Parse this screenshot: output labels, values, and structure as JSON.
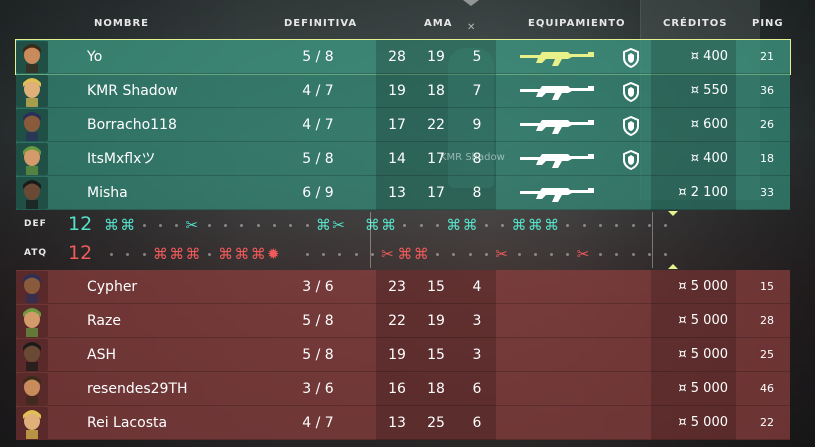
{
  "header": {
    "name": "NOMBRE",
    "final": "DEFINITIVA",
    "kda": "AMA",
    "equipment": "EQUIPAMIENTO",
    "credits": "CRÉDITOS",
    "ping": "PING"
  },
  "colors": {
    "ally": "#328c78",
    "enemy": "#8c3e3e",
    "self_highlight": "#e5f08f",
    "ally_icon": "#55e0c8",
    "enemy_icon": "#f05a5a",
    "weapon_self": "#e8f08a"
  },
  "ally_team": [
    {
      "name": "Yo",
      "definitiva": "5 / 8",
      "kills": "28",
      "deaths": "19",
      "assists": "5",
      "credits": "¤ 400",
      "ping": "21",
      "weapon": "rifle-icon",
      "shield": "shield-icon",
      "self": true
    },
    {
      "name": "KMR Shadow",
      "definitiva": "4 / 7",
      "kills": "19",
      "deaths": "18",
      "assists": "7",
      "credits": "¤ 550",
      "ping": "36",
      "weapon": "rifle-icon",
      "shield": "shield-icon"
    },
    {
      "name": "Borracho118",
      "definitiva": "4 / 7",
      "kills": "17",
      "deaths": "22",
      "assists": "9",
      "credits": "¤ 600",
      "ping": "26",
      "weapon": "rifle-icon",
      "shield": "shield-icon"
    },
    {
      "name": "ItsMxflxツ",
      "definitiva": "5 / 8",
      "kills": "14",
      "deaths": "17",
      "assists": "8",
      "credits": "¤ 400",
      "ping": "18",
      "weapon": "rifle-icon",
      "shield": "shield-icon"
    },
    {
      "name": "Misha",
      "definitiva": "6 / 9",
      "kills": "13",
      "deaths": "17",
      "assists": "8",
      "credits": "¤ 2 100",
      "ping": "33",
      "weapon": "rifle-icon",
      "shield": ""
    }
  ],
  "enemy_team": [
    {
      "name": "Cypher",
      "definitiva": "3 / 6",
      "kills": "23",
      "deaths": "15",
      "assists": "4",
      "credits": "¤ 5 000",
      "ping": "15"
    },
    {
      "name": "Raze",
      "definitiva": "5 / 8",
      "kills": "22",
      "deaths": "19",
      "assists": "3",
      "credits": "¤ 5 000",
      "ping": "28"
    },
    {
      "name": "ASH",
      "definitiva": "5 / 8",
      "kills": "19",
      "deaths": "15",
      "assists": "3",
      "credits": "¤ 5 000",
      "ping": "25"
    },
    {
      "name": "resendes29TH",
      "definitiva": "3 / 6",
      "kills": "16",
      "deaths": "18",
      "assists": "6",
      "credits": "¤ 5 000",
      "ping": "46"
    },
    {
      "name": "Rei Lacosta",
      "definitiva": "4 / 7",
      "kills": "13",
      "deaths": "25",
      "assists": "6",
      "credits": "¤ 5 000",
      "ping": "22"
    }
  ],
  "timeline": {
    "def_label": "DEF",
    "atq_label": "ATQ",
    "def_score": "12",
    "atq_score": "12",
    "def_rounds": [
      "elim",
      "elim",
      "-",
      "-",
      "-",
      "defuse",
      "-",
      "-",
      "-",
      "-",
      "-",
      "-",
      "-",
      "elim",
      "defuse",
      "|",
      "elim",
      "elim",
      "-",
      "-",
      "-",
      "elim",
      "elim",
      "-",
      "-",
      "elim",
      "elim",
      "elim",
      "-",
      "-",
      "-",
      "-",
      "-",
      "-",
      "-"
    ],
    "atq_rounds": [
      "-",
      "-",
      "-",
      "elim",
      "elim",
      "elim",
      "-",
      "elim",
      "elim",
      "elim",
      "detonate",
      "|",
      "-",
      "-",
      "-",
      "-",
      "-",
      "defuse",
      "elim",
      "elim",
      "-",
      "-",
      "-",
      "-",
      "defuse",
      "-",
      "-",
      "-",
      "-",
      "defuse",
      "-",
      "-",
      "-",
      "-",
      "-"
    ]
  },
  "overlay_text": "KMR Shadow"
}
